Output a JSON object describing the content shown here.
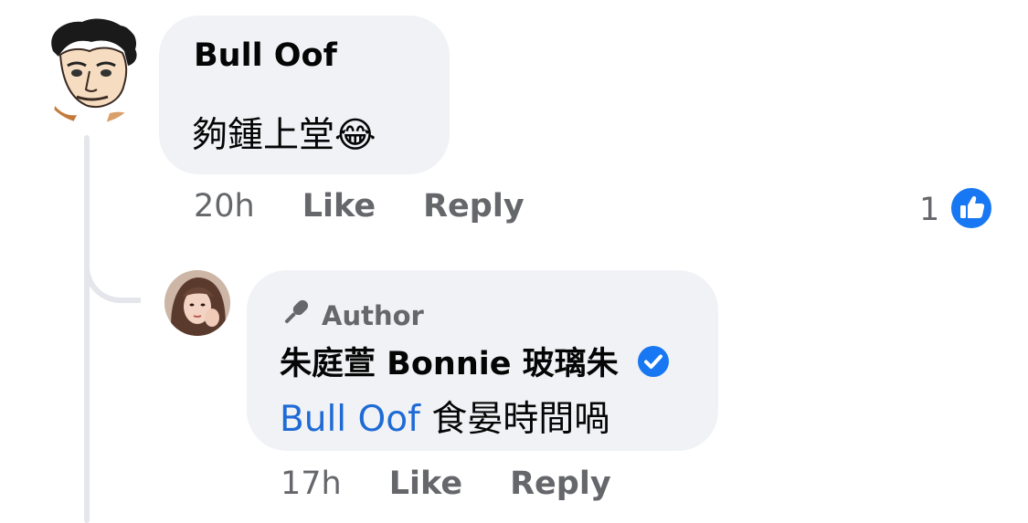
{
  "comments": [
    {
      "author": "Bull Oof",
      "text": "夠鍾上堂",
      "emoji": "😂",
      "time": "20h",
      "like_label": "Like",
      "reply_label": "Reply",
      "reaction_count": "1",
      "reaction_icon": "like-icon"
    },
    {
      "badge": "Author",
      "badge_icon": "microphone-icon",
      "author": "朱庭萱 Bonnie 玻璃朱",
      "verified_icon": "verified-icon",
      "mention": "Bull Oof",
      "text": "食晏時間喎",
      "time": "17h",
      "like_label": "Like",
      "reply_label": "Reply"
    }
  ],
  "colors": {
    "bubble": "#f0f2f5",
    "secondary_text": "#65676b",
    "mention": "#1f6bd6",
    "like_blue": "#1877f2"
  }
}
